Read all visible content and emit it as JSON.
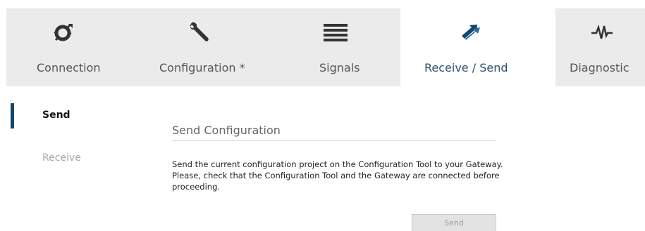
{
  "tabs": [
    {
      "label": "Connection",
      "icon": "connection-plug-icon",
      "active": false
    },
    {
      "label": "Configuration *",
      "icon": "wrench-icon",
      "active": false
    },
    {
      "label": "Signals",
      "icon": "list-icon",
      "active": false
    },
    {
      "label": "Receive / Send",
      "icon": "transfer-arrows-icon",
      "active": true
    },
    {
      "label": "Diagnostic",
      "icon": "pulse-icon",
      "active": false
    }
  ],
  "sidenav": {
    "send_label": "Send",
    "receive_label": "Receive"
  },
  "main": {
    "title": "Send Configuration",
    "description_line1": "Send the current configuration project on the Configuration Tool to your Gateway.",
    "description_line2": "Please, check that the Configuration Tool and the Gateway are connected before",
    "description_line3": "proceeding.",
    "send_button_label": "Send"
  },
  "colors": {
    "accent": "#13466e",
    "icon": "#333333",
    "tabbar_bg": "#ebebeb"
  }
}
